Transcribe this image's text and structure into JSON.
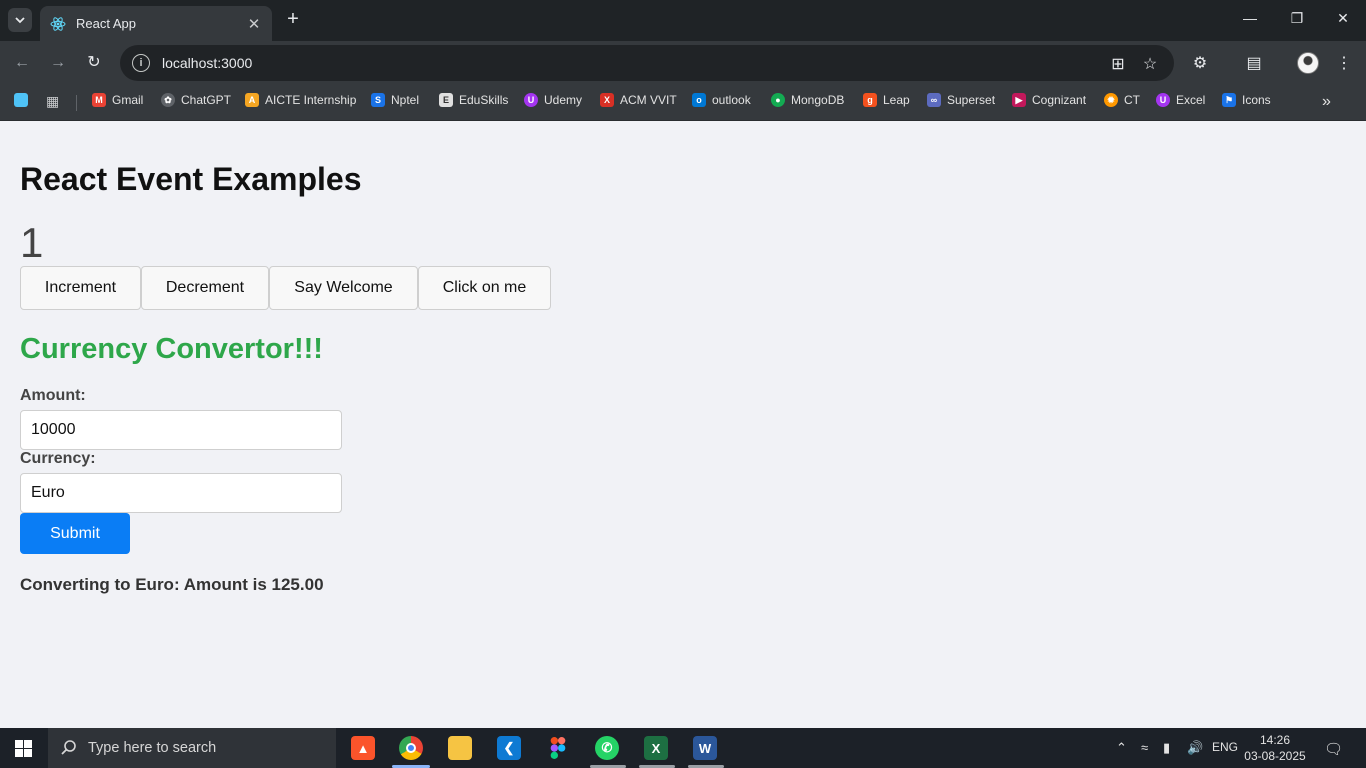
{
  "browser": {
    "tab_title": "React App",
    "url": "localhost:3000",
    "new_tab": "+",
    "tab_close": "✕"
  },
  "bookmarks": [
    {
      "label": "Gmail",
      "color": "#ea4335",
      "icon": "gmail-icon"
    },
    {
      "label": "ChatGPT",
      "color": "#74aa9c",
      "icon": "chatgpt-icon"
    },
    {
      "label": "AICTE Internship",
      "color": "#f5a623",
      "icon": "aicte-icon"
    },
    {
      "label": "Nptel",
      "color": "#1a73e8",
      "icon": "nptel-icon"
    },
    {
      "label": "EduSkills",
      "color": "#e0e0e0",
      "icon": "eduskills-icon"
    },
    {
      "label": "Udemy",
      "color": "#a435f0",
      "icon": "udemy-icon"
    },
    {
      "label": "ACM VVIT",
      "color": "#d93025",
      "icon": "acm-icon"
    },
    {
      "label": "outlook",
      "color": "#0078d4",
      "icon": "outlook-icon"
    },
    {
      "label": "MongoDB",
      "color": "#13aa52",
      "icon": "mongodb-icon"
    },
    {
      "label": "Leap",
      "color": "#f4511e",
      "icon": "leap-icon"
    },
    {
      "label": "Superset",
      "color": "#5c6bc0",
      "icon": "superset-icon"
    },
    {
      "label": "Cognizant",
      "color": "#c2185b",
      "icon": "cognizant-icon"
    },
    {
      "label": "CT",
      "color": "#ff9800",
      "icon": "ct-icon"
    },
    {
      "label": "Excel",
      "color": "#a435f0",
      "icon": "excel-bookmark-icon"
    },
    {
      "label": "Icons",
      "color": "#1a73e8",
      "icon": "icons-bookmark-icon"
    }
  ],
  "page": {
    "heading": "React Event Examples",
    "count": "1",
    "buttons": {
      "increment": "Increment",
      "decrement": "Decrement",
      "welcome": "Say Welcome",
      "click": "Click on me"
    },
    "converter": {
      "heading": "Currency Convertor!!!",
      "amount_label": "Amount:",
      "amount_value": "10000",
      "currency_label": "Currency:",
      "currency_value": "Euro",
      "submit": "Submit",
      "result": "Converting to Euro: Amount is 125.00"
    },
    "colors": {
      "converter_heading": "#2ea74a",
      "submit_bg": "#0a7df5"
    }
  },
  "taskbar": {
    "search_placeholder": "Type here to search",
    "language": "ENG",
    "time": "14:26",
    "date": "03-08-2025"
  }
}
